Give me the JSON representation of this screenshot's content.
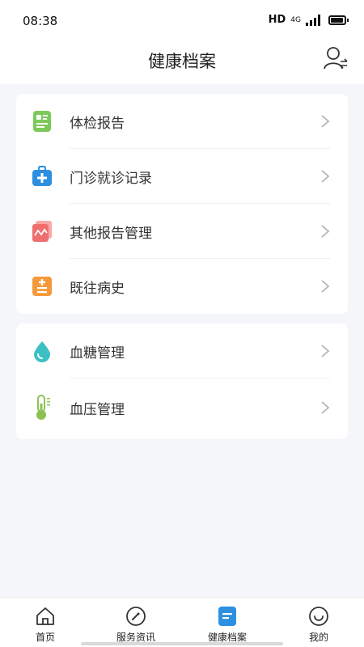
{
  "status_bar": {
    "time": "08:38",
    "hd": "HD",
    "network": "4G"
  },
  "header": {
    "title": "健康档案",
    "right_icon": "user-switch-icon"
  },
  "card_1": {
    "items": [
      {
        "label": "体检报告",
        "icon": "medical-report-icon",
        "color": "#7cc95a"
      },
      {
        "label": "门诊就诊记录",
        "icon": "medical-kit-icon",
        "color": "#2d8fe0"
      },
      {
        "label": "其他报告管理",
        "icon": "chart-document-icon",
        "color": "#ef6f6f"
      },
      {
        "label": "既往病史",
        "icon": "history-list-icon",
        "color": "#f59a3c"
      }
    ]
  },
  "card_2": {
    "items": [
      {
        "label": "血糖管理",
        "icon": "blood-drop-icon",
        "color": "#3bbfc4"
      },
      {
        "label": "血压管理",
        "icon": "thermometer-icon",
        "color": "#8cc152"
      }
    ]
  },
  "tabs": [
    {
      "label": "首页",
      "icon": "home-icon"
    },
    {
      "label": "服务资讯",
      "icon": "compass-icon"
    },
    {
      "label": "健康档案",
      "icon": "health-record-icon",
      "active": true,
      "color": "#2d8fe0"
    },
    {
      "label": "我的",
      "icon": "smile-profile-icon"
    }
  ]
}
